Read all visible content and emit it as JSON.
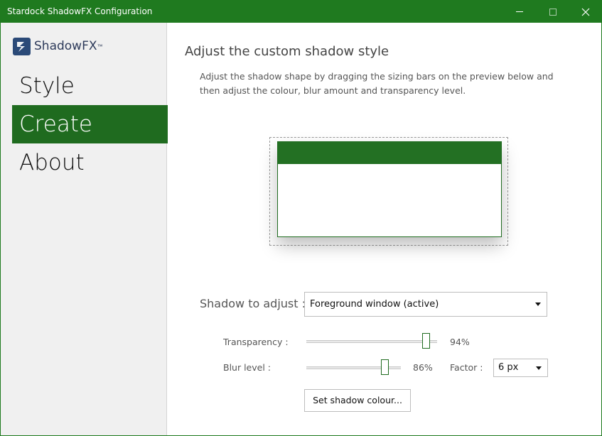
{
  "window": {
    "title": "Stardock ShadowFX Configuration",
    "accent_color": "#1f7a1f"
  },
  "sidebar": {
    "logo_text": "ShadowFX",
    "logo_mark": "™",
    "items": [
      {
        "label": "Style",
        "active": false
      },
      {
        "label": "Create",
        "active": true
      },
      {
        "label": "About",
        "active": false
      }
    ]
  },
  "main": {
    "heading": "Adjust the custom shadow style",
    "description": "Adjust the shadow shape by dragging the sizing bars on the preview below and then adjust the colour, blur amount and transparency level.",
    "shadow_to_adjust_label": "Shadow to adjust :",
    "shadow_to_adjust_value": "Foreground window (active)",
    "transparency": {
      "label": "Transparency :",
      "value_text": "94%",
      "value": 94
    },
    "blur": {
      "label": "Blur level :",
      "value_text": "86%",
      "value": 86
    },
    "factor": {
      "label": "Factor :",
      "value": "6 px"
    },
    "set_colour_button": "Set shadow colour..."
  }
}
